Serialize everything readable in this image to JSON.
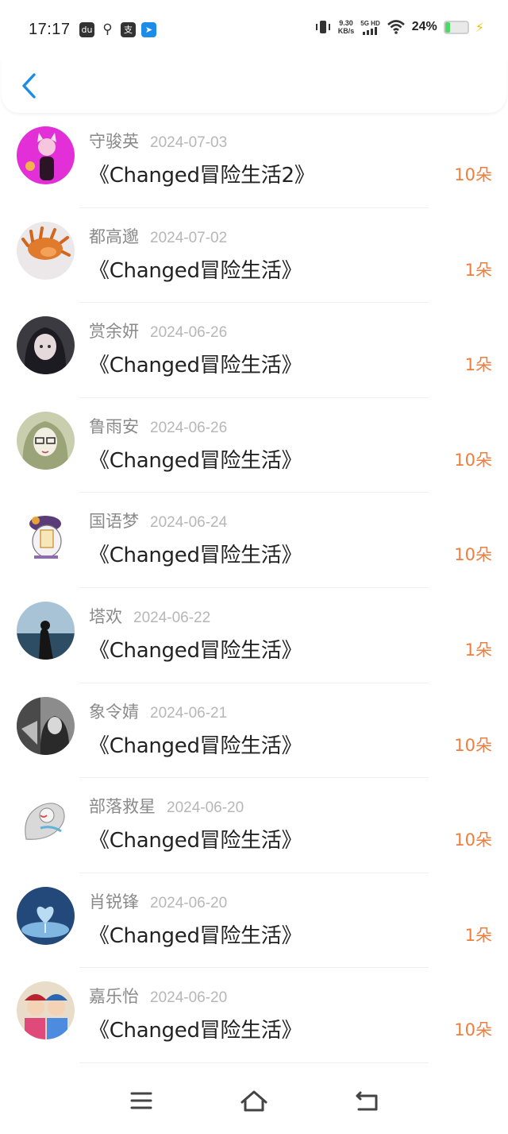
{
  "status_bar": {
    "time": "17:17",
    "speed_value": "9.30",
    "speed_unit": "KB/s",
    "network": "5G HD",
    "battery_percent": "24%",
    "battery_level": 0.24,
    "icons": [
      "baidu-icon",
      "location-icon",
      "alipay-icon",
      "app-icon",
      "vibrate-icon",
      "signal-icon",
      "wifi-icon",
      "battery-icon",
      "charging-icon"
    ]
  },
  "header": {
    "back_icon": "chevron-left-icon"
  },
  "list": {
    "items": [
      {
        "name": "守骏英",
        "date": "2024-07-03",
        "title": "《Changed冒险生活2》",
        "amount": "10朵"
      },
      {
        "name": "都高邈",
        "date": "2024-07-02",
        "title": "《Changed冒险生活》",
        "amount": "1朵"
      },
      {
        "name": "赏余妍",
        "date": "2024-06-26",
        "title": "《Changed冒险生活》",
        "amount": "1朵"
      },
      {
        "name": "鲁雨安",
        "date": "2024-06-26",
        "title": "《Changed冒险生活》",
        "amount": "10朵"
      },
      {
        "name": "国语梦",
        "date": "2024-06-24",
        "title": "《Changed冒险生活》",
        "amount": "10朵"
      },
      {
        "name": "塔欢",
        "date": "2024-06-22",
        "title": "《Changed冒险生活》",
        "amount": "1朵"
      },
      {
        "name": "象令婧",
        "date": "2024-06-21",
        "title": "《Changed冒险生活》",
        "amount": "10朵"
      },
      {
        "name": "部落救星",
        "date": "2024-06-20",
        "title": "《Changed冒险生活》",
        "amount": "10朵"
      },
      {
        "name": "肖锐锋",
        "date": "2024-06-20",
        "title": "《Changed冒险生活》",
        "amount": "1朵"
      },
      {
        "name": "嘉乐怡",
        "date": "2024-06-20",
        "title": "《Changed冒险生活》",
        "amount": "10朵"
      }
    ]
  },
  "navbar": {
    "icons": [
      "menu-icon",
      "home-icon",
      "back-icon"
    ]
  },
  "colors": {
    "accent_blue": "#1b8de9",
    "amount_orange": "#ef7e3c",
    "name_gray": "#8a8a8a",
    "date_gray": "#b7b7b7"
  }
}
